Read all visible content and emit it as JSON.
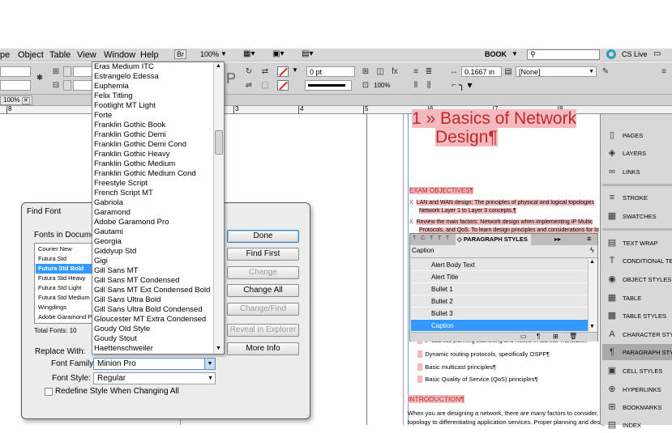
{
  "menubar": {
    "items": [
      "pe",
      "Object",
      "Table",
      "View",
      "Window",
      "Help"
    ],
    "br_badge": "Br",
    "zoom": "100%",
    "workspace": "BOOK",
    "search_placeholder": "",
    "cs_live": "CS Live"
  },
  "control": {
    "stroke_weight": "0 pt",
    "width_value": "0.1667 in",
    "none_style": "[None]",
    "percent": "100%"
  },
  "tabs": {
    "zoom_tab": "100%"
  },
  "ruler": {
    "numbers": [
      "8",
      "1",
      "2",
      "3",
      "4",
      "5",
      "6",
      "7",
      "8",
      "9"
    ]
  },
  "font_list": {
    "items": [
      "Eras Medium ITC",
      "Estrangelo Edessa",
      "Euphemia",
      "Felix Titling",
      "Footlight MT Light",
      "Forte",
      "Franklin Gothic Book",
      "Franklin Gothic Demi",
      "Franklin Gothic Demi Cond",
      "Franklin Gothic Heavy",
      "Franklin Gothic Medium",
      "Franklin Gothic Medium Cond",
      "Freestyle Script",
      "French Script MT",
      "Gabriola",
      "Garamond",
      "Adobe Garamond Pro",
      "Gautami",
      "Georgia",
      "Giddyup Std",
      "Gigi",
      "Gill Sans MT",
      "Gill Sans MT Condensed",
      "Gill Sans MT Ext Condensed Bold",
      "Gill Sans Ultra Bold",
      "Gill Sans Ultra Bold Condensed",
      "Gloucester MT Extra Condensed",
      "Goudy Old Style",
      "Goudy Stout",
      "Haettenschweiler"
    ]
  },
  "find_font": {
    "title": "Find Font",
    "fonts_in_document_label": "Fonts in Documen",
    "fonts": [
      "Courier New",
      "Futura Std",
      "Futura Std Bold",
      "Futura Std Heavy",
      "Futura Std Light",
      "Futura Std Medium",
      "Wingdings",
      "Adobe Garamond Pro",
      "Adobe Garamond Pro"
    ],
    "selected_index": 2,
    "total_fonts": "Total Fonts: 10",
    "replace_with_label": "Replace With:",
    "font_family_label": "Font Family:",
    "font_family_value": "Minion Pro",
    "font_style_label": "Font Style:",
    "font_style_value": "Regular",
    "redefine_label": "Redefine Style When Changing All",
    "buttons": {
      "done": "Done",
      "find_first": "Find First",
      "change": "Change",
      "change_all": "Change All",
      "change_find": "Change/Find",
      "reveal": "Reveal in Explorer",
      "more_info": "More Info"
    }
  },
  "document": {
    "chapter_heading_line1": "1 » Basics of Network",
    "chapter_heading_line2": "Design¶",
    "exam_objectives": "EXAM OBJECTIVES¶",
    "obj1_line1": "LAN and WAN design: The principles of physical and logical topologies",
    "obj1_line2": "Network Layer 1 to Layer 3 concepts.¶",
    "obj2_line1": "Review the main factors: Network design when implementing IP Multic",
    "obj2_line2": "Protocols, and QoS. To learn design principles and considerations for lo",
    "bullet_a": "IP address planning subnetting and Network Address Translation",
    "bullet_b": "Dynamic routing protocols, specifically OSPF¶",
    "bullet_c": "Basic multicast principles¶",
    "bullet_d": "Basic Quality of Service (QoS) principles¶",
    "introduction": "INTRODUCTION¶",
    "intro_line1": "When you are designing a network, there are many factors to consider, ra",
    "intro_line2": "topology to differentiating application services. Proper planning and desig"
  },
  "paragraph_styles": {
    "tab_label": "◇ PARAGRAPH STYLES",
    "current": "Caption",
    "rows": [
      "Alert Body Text",
      "Alert Title",
      "Bullet 1",
      "Bullet 2",
      "Bullet 3",
      "Caption"
    ],
    "selected_index": 5
  },
  "dock": {
    "items": [
      "PAGES",
      "LAYERS",
      "LINKS",
      "STROKE",
      "SWATCHES",
      "TEXT WRAP",
      "CONDITIONAL TE",
      "OBJECT STYLES",
      "TABLE",
      "TABLE STYLES",
      "CHARACTER STYL",
      "PARAGRAPH STY",
      "CELL STYLES",
      "HYPERLINKS",
      "BOOKMARKS",
      "INDEX"
    ],
    "icons": [
      "pages-icon",
      "layers-icon",
      "links-icon",
      "stroke-icon",
      "swatches-icon",
      "text-wrap-icon",
      "conditional-text-icon",
      "object-styles-icon",
      "table-icon",
      "table-styles-icon",
      "character-styles-icon",
      "paragraph-styles-icon",
      "cell-styles-icon",
      "hyperlinks-icon",
      "bookmarks-icon",
      "index-icon"
    ],
    "selected_index": 11
  }
}
